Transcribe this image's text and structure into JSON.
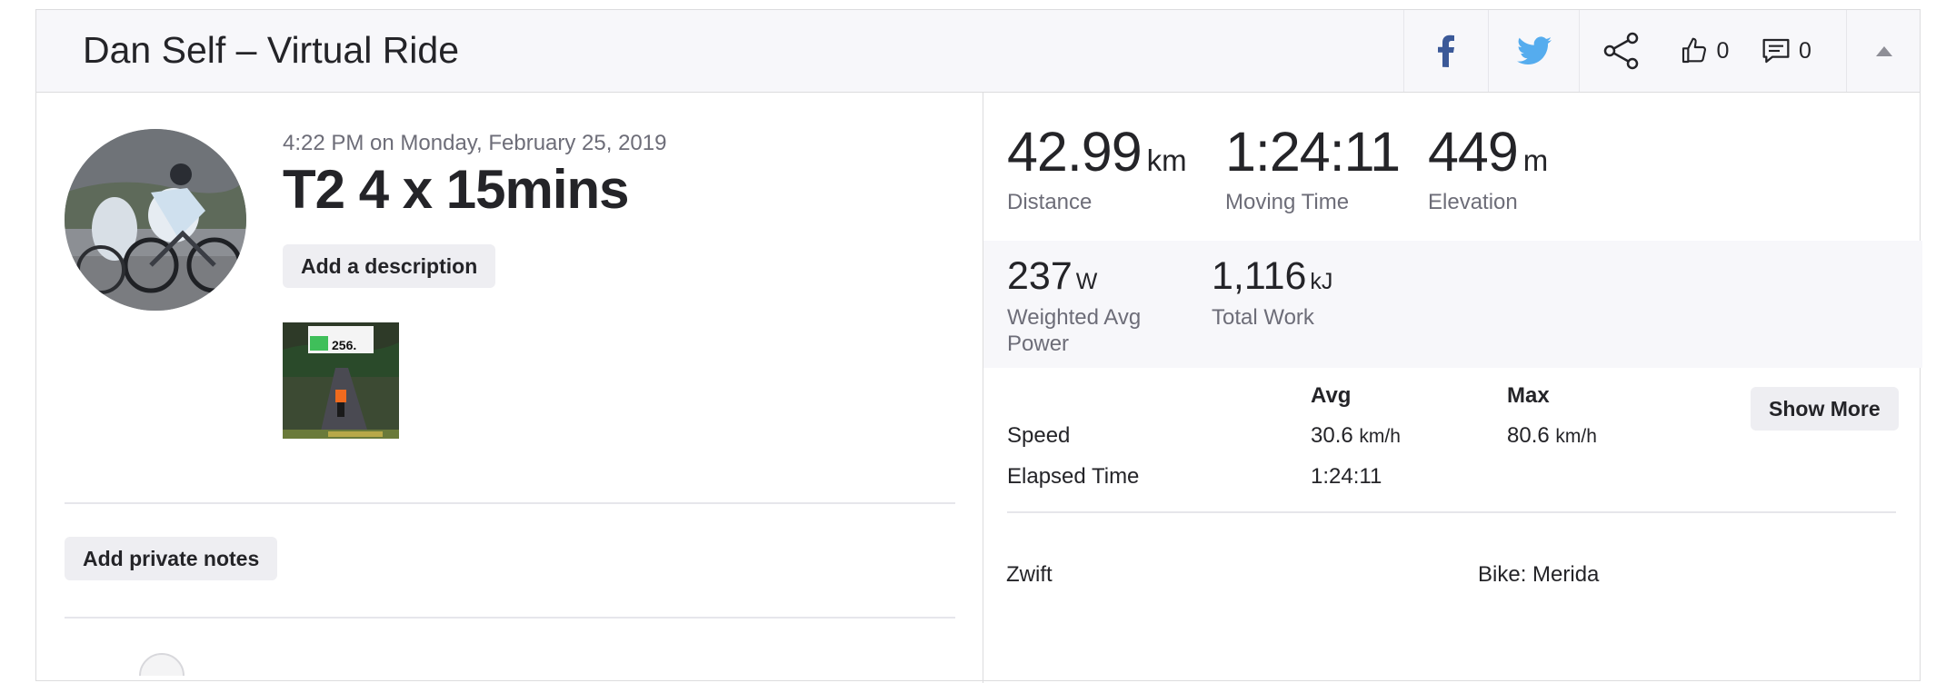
{
  "header": {
    "title": "Dan Self – Virtual Ride",
    "kudos_count": "0",
    "comments_count": "0"
  },
  "activity": {
    "date": "4:22 PM on Monday, February 25, 2019",
    "name": "T2 4 x 15mins",
    "add_description_label": "Add a description",
    "add_private_notes_label": "Add private notes"
  },
  "stats": {
    "primary": [
      {
        "value": "42.99",
        "unit": "km",
        "label": "Distance"
      },
      {
        "value": "1:24:11",
        "unit": "",
        "label": "Moving Time"
      },
      {
        "value": "449",
        "unit": "m",
        "label": "Elevation"
      }
    ],
    "secondary": [
      {
        "value": "237",
        "unit": "W",
        "label": "Weighted Avg Power"
      },
      {
        "value": "1,116",
        "unit": "kJ",
        "label": "Total Work"
      }
    ]
  },
  "details": {
    "col_avg": "Avg",
    "col_max": "Max",
    "show_more_label": "Show More",
    "rows": [
      {
        "label": "Speed",
        "avg": "30.6",
        "avg_unit": "km/h",
        "max": "80.6",
        "max_unit": "km/h"
      },
      {
        "label": "Elapsed Time",
        "avg": "1:24:11",
        "avg_unit": "",
        "max": "",
        "max_unit": ""
      }
    ]
  },
  "device": {
    "app": "Zwift",
    "bike": "Bike: Merida"
  },
  "thumbnail": {
    "overlay_value": "256."
  },
  "colors": {
    "facebook": "#3b5998",
    "twitter": "#55acee",
    "text": "#242428",
    "muted": "#6d6d78",
    "panel_bg": "#f7f7fa"
  }
}
